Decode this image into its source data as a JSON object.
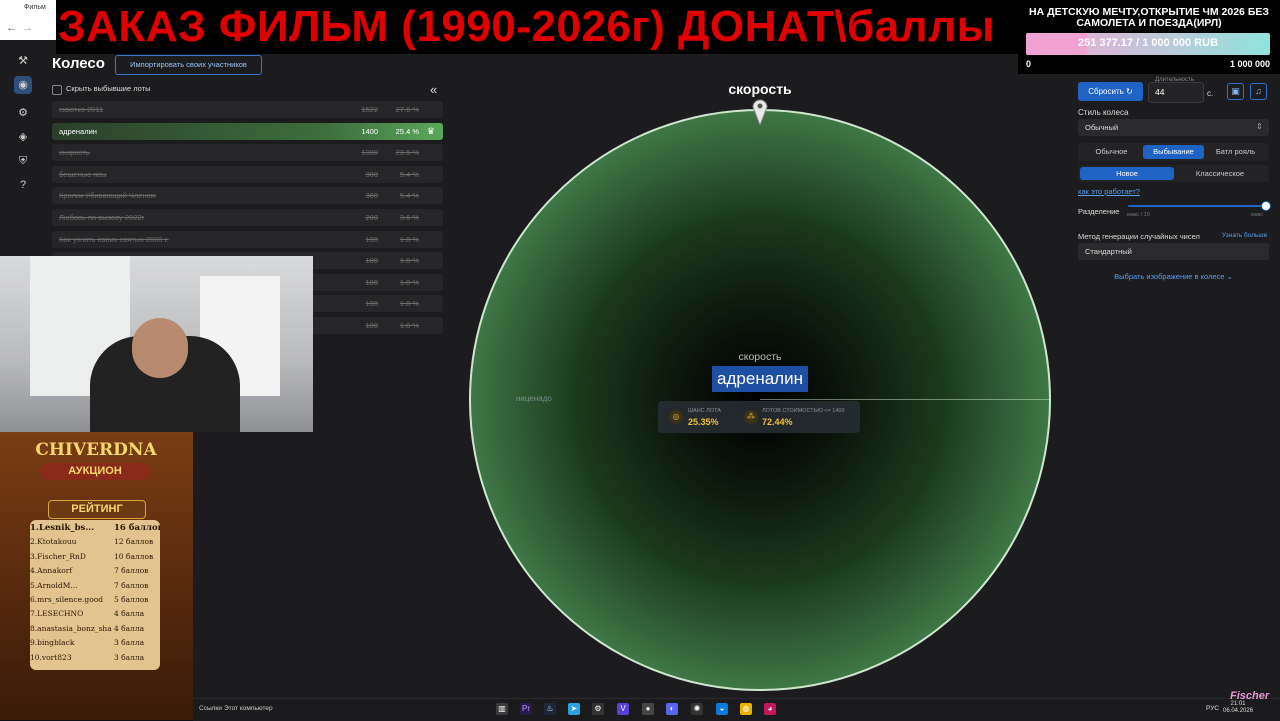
{
  "browser": {
    "tab_label": "Фильм"
  },
  "banner": {
    "title": "ЗАКАЗ ФИЛЬМ (1990-2026г) ДОНАТ\\баллы"
  },
  "donation": {
    "goal_title": "НА ДЕТСКУЮ МЕЧТУ,ОТКРЫТИЕ ЧМ 2026 БЕЗ САМОЛЕТА И ПОЕЗДА(ИРЛ)",
    "amount_text": "251 377.17 / 1 000 000 RUB",
    "progress_fraction": 0.2514,
    "min": "0",
    "max": "1 000 000"
  },
  "panel": {
    "title": "Колесо",
    "import_label": "Импортировать своих участников",
    "hide_label": "Скрыть выбывшие лоты",
    "collapse_icon": "double-chevron-left"
  },
  "lots": [
    {
      "name": "сквотко 2011",
      "amount": "1522",
      "percent": "27.6 %",
      "eliminated": true
    },
    {
      "name": "адреналин",
      "amount": "1400",
      "percent": "25.4 %",
      "eliminated": false,
      "selected": true
    },
    {
      "name": "скорость",
      "amount": "1300",
      "percent": "23.5 %",
      "eliminated": true
    },
    {
      "name": "бешеные псы",
      "amount": "300",
      "percent": "5.4 %",
      "eliminated": true
    },
    {
      "name": "Кролик Убивающий Членом",
      "amount": "300",
      "percent": "5.4 %",
      "eliminated": true
    },
    {
      "name": "Любовь по вызову 2022г",
      "amount": "200",
      "percent": "3.6 %",
      "eliminated": true
    },
    {
      "name": "Как узнать своих святых 2006 г.",
      "amount": "100",
      "percent": "1.8 %",
      "eliminated": true
    },
    {
      "name": "",
      "amount": "100",
      "percent": "1.8 %",
      "eliminated": true
    },
    {
      "name": "",
      "amount": "100",
      "percent": "1.8 %",
      "eliminated": true
    },
    {
      "name": "",
      "amount": "100",
      "percent": "1.8 %",
      "eliminated": true
    },
    {
      "name": "",
      "amount": "100",
      "percent": "1.8 %",
      "eliminated": true
    }
  ],
  "poster": {
    "title": "CHIVERDNA",
    "subtitle": "АУКЦИОН",
    "rating_label": "РЕЙТИНГ",
    "entries": [
      {
        "rank": "1.Lesnik_bs...",
        "score": "16 баллов"
      },
      {
        "rank": "2.Ktotakouu",
        "score": "12 баллов"
      },
      {
        "rank": "3.Fischer_RnD",
        "score": "10 баллов"
      },
      {
        "rank": "4.Annakorf",
        "score": "7 баллов"
      },
      {
        "rank": "5.ArnoldM...",
        "score": "7 баллов"
      },
      {
        "rank": "6.mrs_silence.good",
        "score": "5 баллов"
      },
      {
        "rank": "7.LESECHNO",
        "score": "4 балла"
      },
      {
        "rank": "8.anastasia_bonz_sha",
        "score": "4 балла"
      },
      {
        "rank": "9.bingblack",
        "score": "3 балла"
      },
      {
        "rank": "10.vort823",
        "score": "3 балла"
      }
    ]
  },
  "wheel": {
    "pointer_label": "скорость",
    "previous_label": "скорость",
    "winner": "адреналин",
    "faded_label": "ниценадо",
    "stats": {
      "chance_label": "ШАНС ЛОТА",
      "chance_value": "25.35%",
      "lots_label": "ЛОТОВ СТОИМОСТЬЮ <= 1400",
      "lots_value": "72.44%"
    }
  },
  "settings": {
    "reset_label": "Сбросить",
    "duration_label": "Длительность",
    "duration_value": "44",
    "duration_unit": "с.",
    "style_label": "Стиль колеса",
    "style_value": "Обычный",
    "modes": [
      "Обычное",
      "Выбывание",
      "Батл рояль"
    ],
    "active_mode": 1,
    "variants": [
      "Новое",
      "Классическое"
    ],
    "active_variant": 0,
    "how_link": "как это работает?",
    "split_label": "Разделение",
    "split_min": "макс / 10",
    "split_max": "макс",
    "rng_label": "Метод генерации случайных чисел",
    "rng_more": "Узнать больше",
    "rng_value": "Стандартный",
    "image_link": "Выбрать изображение в колесе"
  },
  "taskbar": {
    "links": "Ссылки",
    "pc": "Этот компьютер",
    "lang": "РУС",
    "time": "21:01",
    "date": "06.04.2026"
  },
  "watermark": "Fischer",
  "colors": {
    "accent": "#1f63c5",
    "banner_red": "#e00000",
    "wheel_green": "#7dbb82"
  }
}
